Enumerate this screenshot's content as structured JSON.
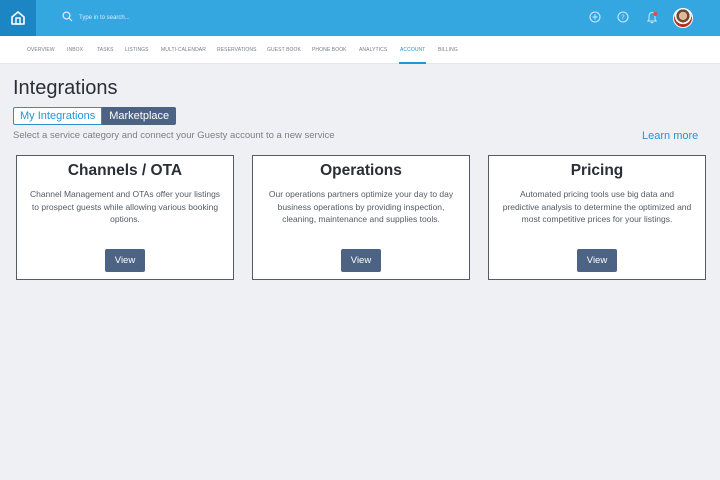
{
  "topbar": {
    "search_placeholder": "Type in to search...",
    "colors": {
      "bar": "#34a7e1",
      "logo_bg": "#1c86c4"
    },
    "icons": [
      "home-logo-icon",
      "search-icon",
      "plus-circle-icon",
      "help-circle-icon",
      "notification-bell-icon",
      "user-avatar"
    ]
  },
  "nav": {
    "items": [
      "OVERVIEW",
      "INBOX",
      "TASKS",
      "LISTINGS",
      "MULTI-CALENDAR",
      "RESERVATIONS",
      "GUEST BOOK",
      "PHONE BOOK",
      "ANALYTICS",
      "ACCOUNT",
      "BILLING"
    ],
    "active": "ACCOUNT"
  },
  "page": {
    "title": "Integrations",
    "tabs": {
      "my_integrations": "My Integrations",
      "marketplace": "Marketplace",
      "selected": "Marketplace"
    },
    "subtitle": "Select a service category and connect your Guesty account to a new service",
    "learn_more": "Learn more"
  },
  "cards": [
    {
      "title": "Channels / OTA",
      "description": "Channel Management and OTAs offer your listings to prospect guests while allowing various booking options.",
      "button": "View"
    },
    {
      "title": "Operations",
      "description": "Our operations partners optimize your day to day business operations by providing inspection, cleaning, maintenance and supplies tools.",
      "button": "View"
    },
    {
      "title": "Pricing",
      "description": "Automated pricing tools use big data and predictive analysis to determine the optimized and most competitive prices for your listings.",
      "button": "View"
    }
  ]
}
